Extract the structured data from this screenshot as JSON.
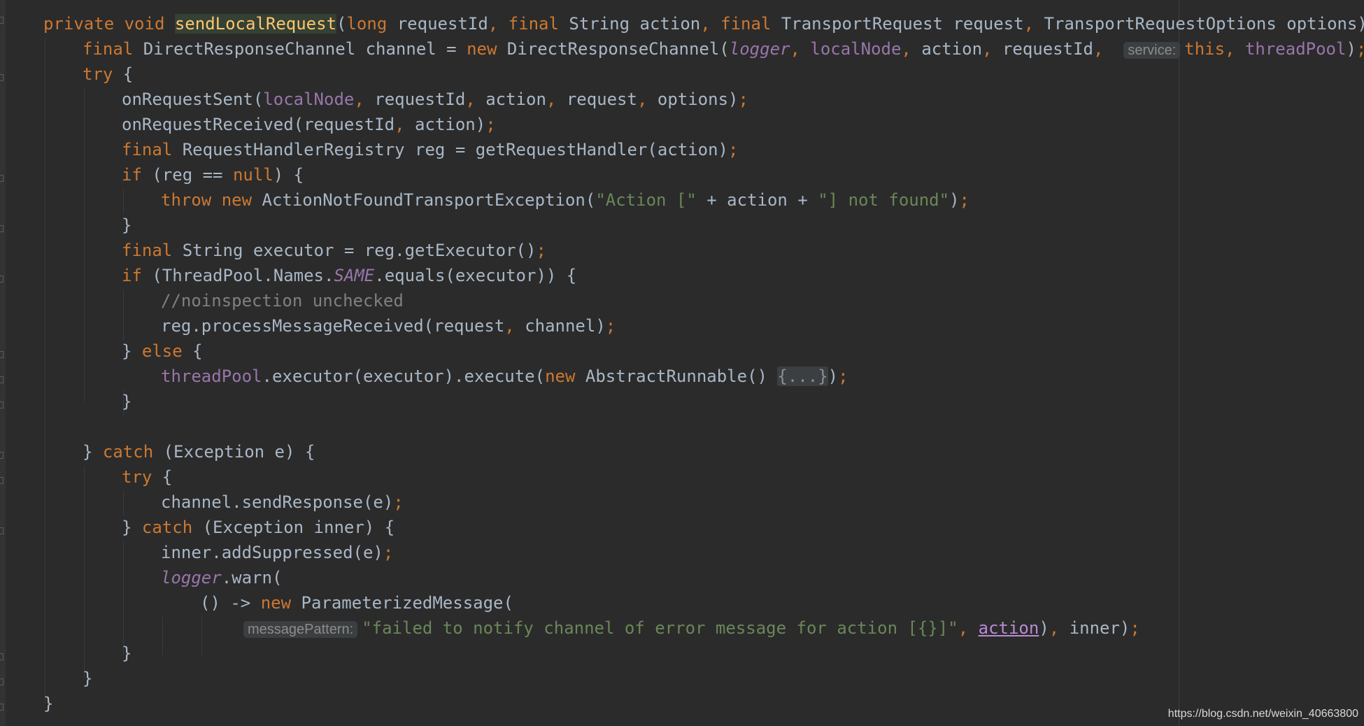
{
  "editor": {
    "language": "Java",
    "method_name": "sendLocalRequest",
    "hints": {
      "service": "service:",
      "message_pattern": "messagePattern:"
    },
    "fold_placeholder": "{...}"
  },
  "watermark": "https://blog.csdn.net/weixin_40663800"
}
